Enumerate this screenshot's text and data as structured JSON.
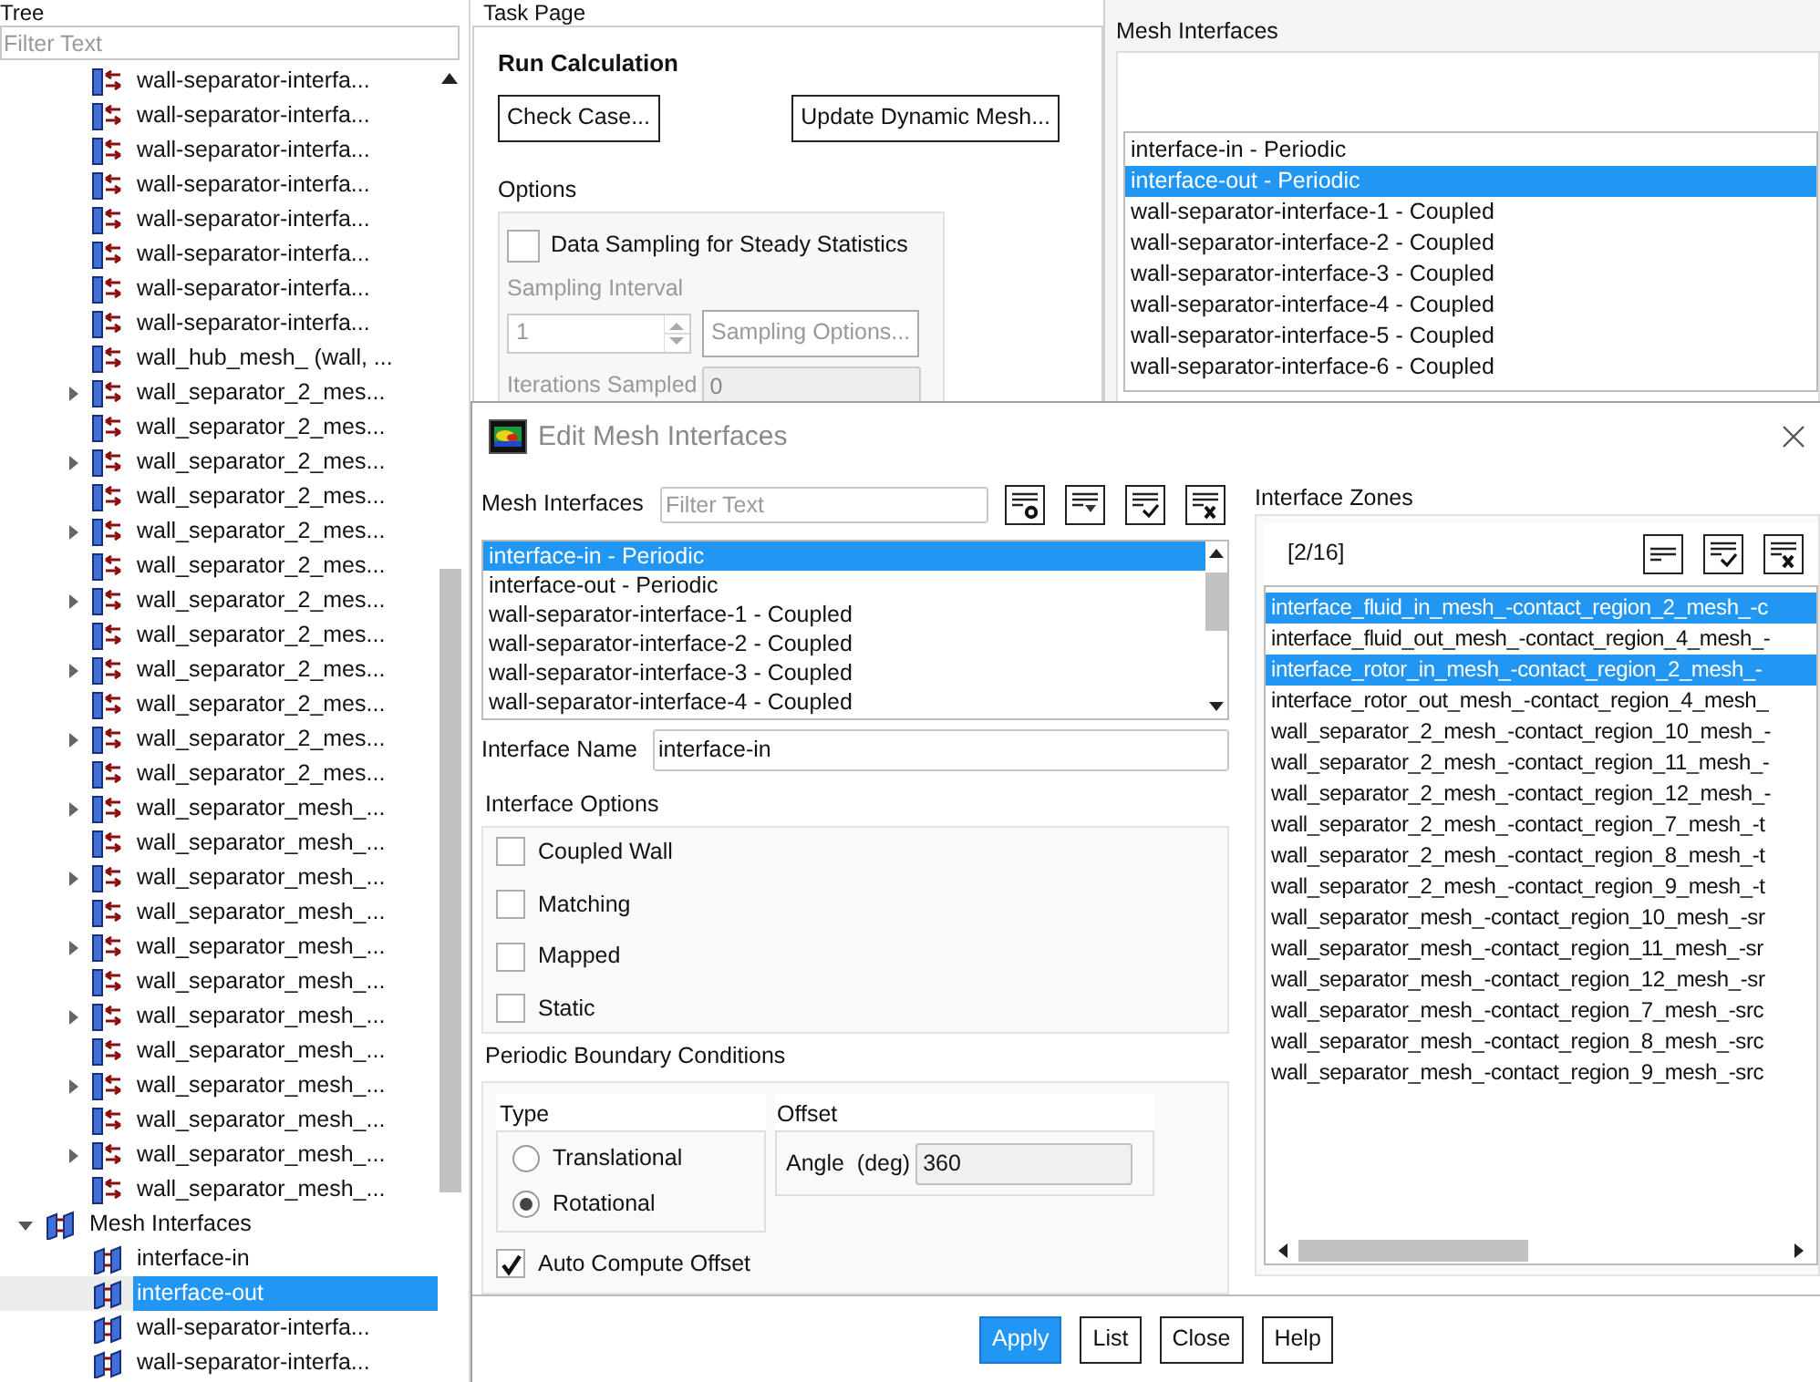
{
  "tree": {
    "title": "Tree",
    "filter_placeholder": "Filter Text",
    "items": [
      {
        "children": [
          {
            "label": "wall-separator-interfa...",
            "kind": "zone",
            "selected": false
          },
          {
            "label": "wall-separator-interfa...",
            "kind": "zone",
            "selected": false
          },
          {
            "label": "wall-separator-interfa...",
            "kind": "zone",
            "selected": false
          },
          {
            "label": "wall-separator-interfa...",
            "kind": "zone",
            "selected": false
          },
          {
            "label": "wall-separator-interfa...",
            "kind": "zone",
            "selected": false
          },
          {
            "label": "wall-separator-interfa...",
            "kind": "zone",
            "selected": false
          },
          {
            "label": "wall-separator-interfa...",
            "kind": "zone",
            "selected": false
          },
          {
            "label": "wall-separator-interfa...",
            "kind": "zone",
            "selected": false
          },
          {
            "label": "wall_hub_mesh_ (wall, ...",
            "kind": "zone",
            "selected": false
          },
          {
            "label": "wall_separator_2_mes...",
            "kind": "zone",
            "selected": false,
            "expanded": false
          },
          {
            "label": "wall_separator_2_mes...",
            "kind": "zone",
            "selected": false
          },
          {
            "label": "wall_separator_2_mes...",
            "kind": "zone",
            "selected": false,
            "expanded": false
          },
          {
            "label": "wall_separator_2_mes...",
            "kind": "zone",
            "selected": false
          },
          {
            "label": "wall_separator_2_mes...",
            "kind": "zone",
            "selected": false,
            "expanded": false
          },
          {
            "label": "wall_separator_2_mes...",
            "kind": "zone",
            "selected": false
          },
          {
            "label": "wall_separator_2_mes...",
            "kind": "zone",
            "selected": false,
            "expanded": false
          },
          {
            "label": "wall_separator_2_mes...",
            "kind": "zone",
            "selected": false
          },
          {
            "label": "wall_separator_2_mes...",
            "kind": "zone",
            "selected": false,
            "expanded": false
          },
          {
            "label": "wall_separator_2_mes...",
            "kind": "zone",
            "selected": false
          },
          {
            "label": "wall_separator_2_mes...",
            "kind": "zone",
            "selected": false,
            "expanded": false
          },
          {
            "label": "wall_separator_2_mes...",
            "kind": "zone",
            "selected": false
          },
          {
            "label": "wall_separator_mesh_...",
            "kind": "zone",
            "selected": false,
            "expanded": false
          },
          {
            "label": "wall_separator_mesh_...",
            "kind": "zone",
            "selected": false
          },
          {
            "label": "wall_separator_mesh_...",
            "kind": "zone",
            "selected": false,
            "expanded": false
          },
          {
            "label": "wall_separator_mesh_...",
            "kind": "zone",
            "selected": false
          },
          {
            "label": "wall_separator_mesh_...",
            "kind": "zone",
            "selected": false,
            "expanded": false
          },
          {
            "label": "wall_separator_mesh_...",
            "kind": "zone",
            "selected": false
          },
          {
            "label": "wall_separator_mesh_...",
            "kind": "zone",
            "selected": false,
            "expanded": false
          },
          {
            "label": "wall_separator_mesh_...",
            "kind": "zone",
            "selected": false
          },
          {
            "label": "wall_separator_mesh_...",
            "kind": "zone",
            "selected": false,
            "expanded": false
          },
          {
            "label": "wall_separator_mesh_...",
            "kind": "zone",
            "selected": false
          },
          {
            "label": "wall_separator_mesh_...",
            "kind": "zone",
            "selected": false,
            "expanded": false
          },
          {
            "label": "wall_separator_mesh_...",
            "kind": "zone",
            "selected": false
          }
        ]
      },
      {
        "label": "Mesh Interfaces",
        "kind": "group",
        "selected": false,
        "expanded": true,
        "children": [
          {
            "label": "interface-in",
            "kind": "interface",
            "selected": false
          },
          {
            "label": "interface-out",
            "kind": "interface",
            "selected": true
          },
          {
            "label": "wall-separator-interfa...",
            "kind": "interface",
            "selected": false
          },
          {
            "label": "wall-separator-interfa...",
            "kind": "interface",
            "selected": false
          }
        ]
      }
    ]
  },
  "task_page": {
    "title": "Task Page",
    "heading": "Run Calculation",
    "buttons": [
      "Check Case...",
      "Update Dynamic Mesh..."
    ],
    "options": {
      "title": "Options",
      "sampling": {
        "label": "Data Sampling for Steady Statistics",
        "checked": false
      },
      "sampling_interval": {
        "label": "Sampling Interval",
        "value": "1",
        "disabled": true
      },
      "sampling_options": {
        "label": "Sampling Options...",
        "disabled": true
      },
      "iterations_sampled": {
        "label": "Iterations Sampled",
        "value": "0",
        "disabled": true
      }
    }
  },
  "mesh_panel": {
    "title": "Mesh Interfaces",
    "items": [
      {
        "label": "interface-in - Periodic",
        "selected": false
      },
      {
        "label": "interface-out - Periodic",
        "selected": true
      },
      {
        "label": "wall-separator-interface-1 - Coupled",
        "selected": false
      },
      {
        "label": "wall-separator-interface-2 - Coupled",
        "selected": false
      },
      {
        "label": "wall-separator-interface-3 - Coupled",
        "selected": false
      },
      {
        "label": "wall-separator-interface-4 - Coupled",
        "selected": false
      },
      {
        "label": "wall-separator-interface-5 - Coupled",
        "selected": false
      },
      {
        "label": "wall-separator-interface-6 - Coupled",
        "selected": false
      }
    ]
  },
  "dialog": {
    "title": "Edit Mesh Interfaces",
    "interfaces": {
      "label": "Mesh Interfaces",
      "filter_placeholder": "Filter Text",
      "items": [
        {
          "label": "interface-in - Periodic",
          "selected": true
        },
        {
          "label": "interface-out - Periodic",
          "selected": false
        },
        {
          "label": "wall-separator-interface-1 - Coupled",
          "selected": false
        },
        {
          "label": "wall-separator-interface-2 - Coupled",
          "selected": false
        },
        {
          "label": "wall-separator-interface-3 - Coupled",
          "selected": false
        },
        {
          "label": "wall-separator-interface-4 - Coupled",
          "selected": false
        }
      ]
    },
    "interface_name": {
      "label": "Interface Name",
      "value": "interface-in"
    },
    "interface_options": {
      "title": "Interface Options",
      "items": [
        {
          "label": "Coupled Wall",
          "checked": false
        },
        {
          "label": "Matching",
          "checked": false
        },
        {
          "label": "Mapped",
          "checked": false
        },
        {
          "label": "Static",
          "checked": false
        }
      ]
    },
    "periodic": {
      "title": "Periodic Boundary Conditions",
      "type_label": "Type",
      "types": [
        {
          "label": "Translational",
          "selected": false
        },
        {
          "label": "Rotational",
          "selected": true
        }
      ],
      "offset_label": "Offset",
      "angle_label": "Angle  (deg)",
      "angle_value": "360",
      "auto_compute": {
        "label": "Auto Compute Offset",
        "checked": true
      }
    },
    "zones": {
      "title": "Interface Zones",
      "count": "[2/16]",
      "items": [
        {
          "label": "interface_fluid_in_mesh_-contact_region_2_mesh_-c",
          "selected": true
        },
        {
          "label": "interface_fluid_out_mesh_-contact_region_4_mesh_-",
          "selected": false
        },
        {
          "label": "interface_rotor_in_mesh_-contact_region_2_mesh_-",
          "selected": true
        },
        {
          "label": "interface_rotor_out_mesh_-contact_region_4_mesh_",
          "selected": false
        },
        {
          "label": "wall_separator_2_mesh_-contact_region_10_mesh_-",
          "selected": false
        },
        {
          "label": "wall_separator_2_mesh_-contact_region_11_mesh_-",
          "selected": false
        },
        {
          "label": "wall_separator_2_mesh_-contact_region_12_mesh_-",
          "selected": false
        },
        {
          "label": "wall_separator_2_mesh_-contact_region_7_mesh_-t",
          "selected": false
        },
        {
          "label": "wall_separator_2_mesh_-contact_region_8_mesh_-t",
          "selected": false
        },
        {
          "label": "wall_separator_2_mesh_-contact_region_9_mesh_-t",
          "selected": false
        },
        {
          "label": "wall_separator_mesh_-contact_region_10_mesh_-sr",
          "selected": false
        },
        {
          "label": "wall_separator_mesh_-contact_region_11_mesh_-sr",
          "selected": false
        },
        {
          "label": "wall_separator_mesh_-contact_region_12_mesh_-sr",
          "selected": false
        },
        {
          "label": "wall_separator_mesh_-contact_region_7_mesh_-src",
          "selected": false
        },
        {
          "label": "wall_separator_mesh_-contact_region_8_mesh_-src",
          "selected": false
        },
        {
          "label": "wall_separator_mesh_-contact_region_9_mesh_-src",
          "selected": false
        }
      ]
    },
    "buttons": [
      {
        "label": "Apply",
        "kind": "primary"
      },
      {
        "label": "List",
        "kind": "normal"
      },
      {
        "label": "Close",
        "kind": "normal"
      },
      {
        "label": "Help",
        "kind": "normal"
      }
    ]
  }
}
